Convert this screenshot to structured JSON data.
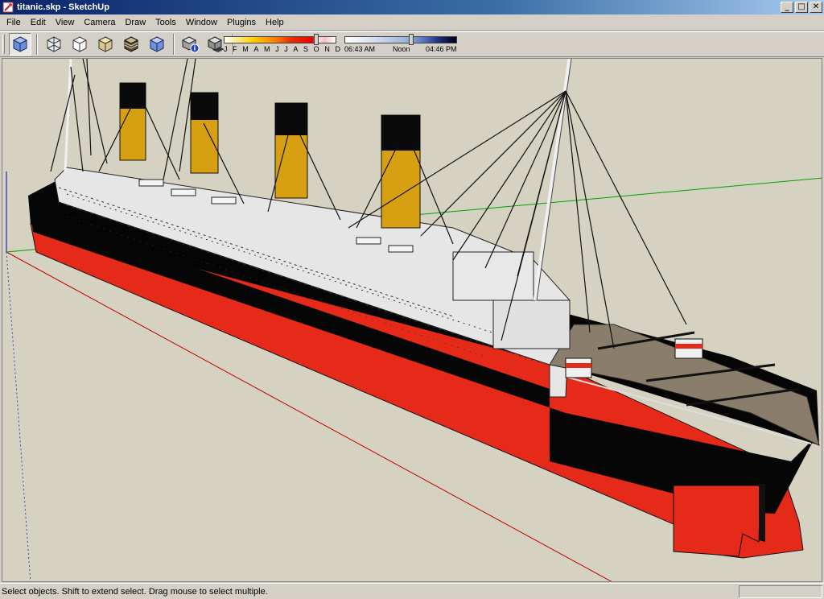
{
  "window": {
    "title": "titanic.skp - SketchUp",
    "controls": {
      "minimize": "_",
      "maximize": "□",
      "close": "✕"
    }
  },
  "menu": {
    "items": [
      "File",
      "Edit",
      "View",
      "Camera",
      "Draw",
      "Tools",
      "Window",
      "Plugins",
      "Help"
    ]
  },
  "toolbar": {
    "buttons": [
      {
        "name": "iso-view-button",
        "icon": "iso-cube-icon"
      },
      {
        "name": "xray-button",
        "icon": "xray-cube-icon"
      },
      {
        "name": "wireframe-button",
        "icon": "wireframe-cube-icon"
      },
      {
        "name": "hidden-line-button",
        "icon": "hidden-line-cube-icon"
      },
      {
        "name": "shaded-button",
        "icon": "shaded-cube-icon"
      },
      {
        "name": "shaded-textures-button",
        "icon": "textured-cube-icon"
      },
      {
        "name": "monochrome-button",
        "icon": "monochrome-cube-icon"
      },
      {
        "name": "shadow-settings-button",
        "icon": "shadow-info-icon"
      },
      {
        "name": "display-shadows-button",
        "icon": "shadow-cube-icon"
      }
    ],
    "shadow_months": [
      "J",
      "F",
      "M",
      "A",
      "M",
      "J",
      "J",
      "A",
      "S",
      "O",
      "N",
      "D"
    ],
    "time_start": "06:43 AM",
    "time_mid": "Noon",
    "time_end": "04:46 PM"
  },
  "status": {
    "message": "Select objects. Shift to extend select. Drag mouse to select multiple.",
    "measurements": ""
  },
  "colors": {
    "viewport_bg": "#d6d2c1",
    "hull_red": "#e52a1a",
    "hull_black": "#050505",
    "funnel_yellow": "#d7a012",
    "superstructure": "#e6e6e6",
    "deck": "#8a7d6c",
    "axis_red": "#c00000",
    "axis_green": "#00a000",
    "axis_blue": "#0000c0"
  }
}
